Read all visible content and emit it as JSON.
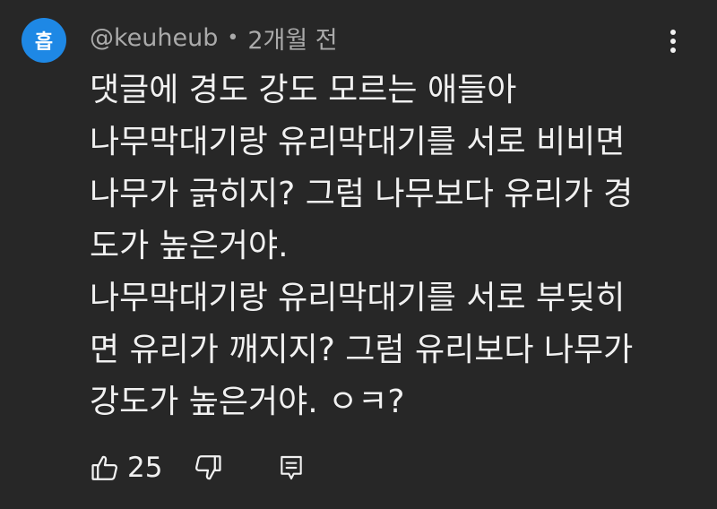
{
  "comment": {
    "avatar_initial": "흡",
    "avatar_color": "#1e88e5",
    "author": "@keuheub",
    "separator": "•",
    "timestamp": "2개월 전",
    "lines": [
      "댓글에 경도 강도 모르는 애들아",
      "나무막대기랑 유리막대기를 서로 비비면",
      "나무가 긁히지? 그럼 나무보다 유리가 경",
      "도가 높은거야.",
      "나무막대기랑 유리막대기를 서로 부딪히",
      "면 유리가 깨지지? 그럼 유리보다 나무가",
      "강도가 높은거야. ㅇㅋ?"
    ],
    "like_count": "25",
    "icons": {
      "like": "thumbs-up-icon",
      "dislike": "thumbs-down-icon",
      "reply": "reply-icon",
      "menu": "more-vert-icon"
    }
  }
}
